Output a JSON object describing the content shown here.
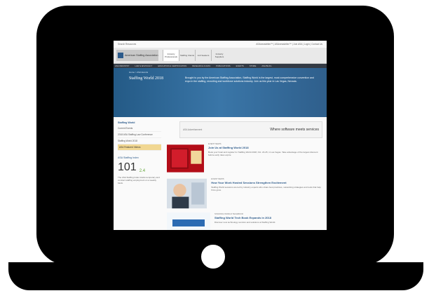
{
  "topbar": {
    "left": "Search Resources",
    "right": "ASAnewsletter™ | ASAnewsletter™ | Join ASA | Login | Contact Us"
  },
  "brand": {
    "name": "American Staffing Association",
    "tabs": [
      "Industry Professionals",
      "Staffing Clients",
      "Job Seekers",
      "Industry Suppliers"
    ]
  },
  "nav": [
    "ASA INDUSTRY",
    "LAW & ADVOCACY",
    "EDUCATION & CERTIFICATION",
    "RESEARCH & DATA",
    "PUBLICATIONS",
    "EVENTS",
    "STORE",
    "ASA BLOG"
  ],
  "hero": {
    "crumb": "Home > ASA Events",
    "title": "Staffing World 2018",
    "text": "Brought to you by the American Staffing Association, Staffing World is the largest, most comprehensive convention and expo in the staffing, recruiting and workforce solutions industry. Join us this year in Las Vegas, Nevada."
  },
  "sidebar": {
    "heading": "Staffing World",
    "links": [
      "Current Events",
      "2018 ASA Staffing Law Conference",
      "Staffing World 2018",
      "ASA Featured Videos"
    ],
    "highlight_index": 3,
    "sales_heading": "ASA Staffing Index",
    "sales_number": "101",
    "sales_delta": "2.4",
    "sales_note": "The ASA Staffing Index tracks temporary and contract staffing employment on a weekly basis."
  },
  "ad": {
    "tag": "ASA Advertisement",
    "message": "Where software meets services"
  },
  "cards": [
    {
      "meta": "EVENT NEWS",
      "title": "Join Us at Staffing World 2018",
      "excerpt": "Book your hotel and register for Staffing World 2018, Oct. 23-25, in Las Vegas. Take advantage of the largest discount before early rates expire."
    },
    {
      "meta": "EVENT NEWS",
      "title": "How Your Work Hosted Sessions Strengthen Excitement",
      "excerpt": "Staffing World sessions are led by industry experts who share best practices, networking strategies and tools that help firms grow."
    },
    {
      "meta": "STAFFING WORLD TECHBOOK",
      "title": "Staffing World Tech Book Expands in 2018",
      "excerpt": "Discover new technology vendors and solutions at Staffing World."
    }
  ]
}
